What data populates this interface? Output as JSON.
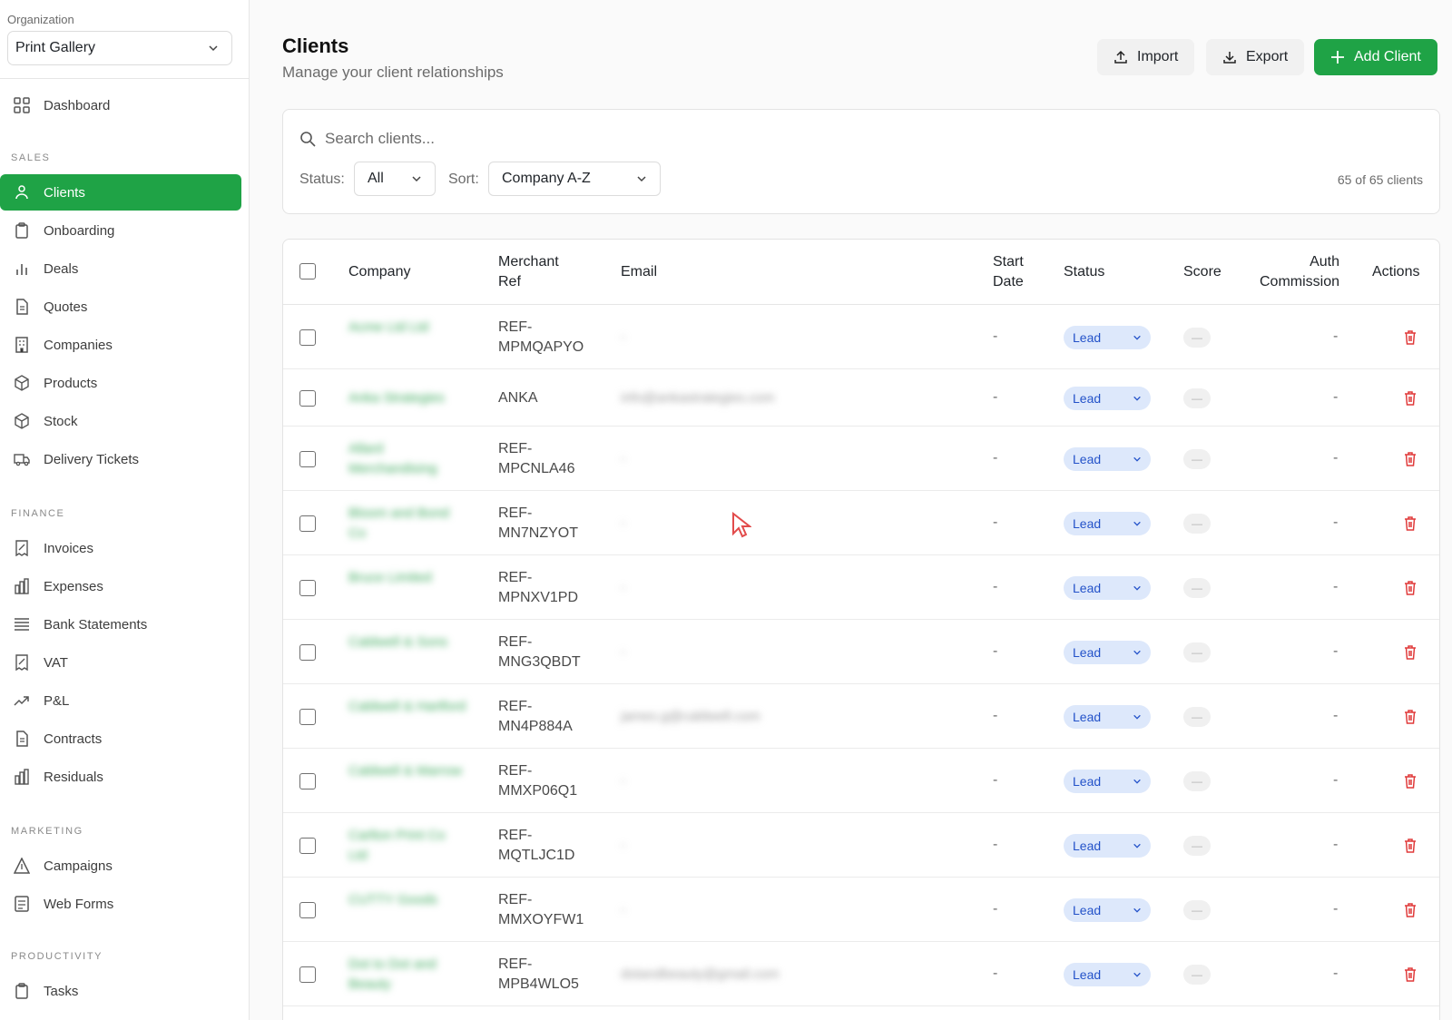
{
  "sidebar": {
    "org_label": "Organization",
    "org_value": "Print Gallery",
    "dashboard": "Dashboard",
    "sections": [
      "Sales",
      "Finance",
      "Marketing",
      "Productivity"
    ],
    "sales": [
      "Clients",
      "Onboarding",
      "Deals",
      "Quotes",
      "Companies",
      "Products",
      "Stock",
      "Delivery Tickets"
    ],
    "finance": [
      "Invoices",
      "Expenses",
      "Bank Statements",
      "VAT",
      "P&L",
      "Contracts",
      "Residuals"
    ],
    "marketing": [
      "Campaigns",
      "Web Forms"
    ],
    "productivity": [
      "Tasks"
    ],
    "active": "Clients"
  },
  "header": {
    "title": "Clients",
    "subtitle": "Manage your client relationships",
    "import": "Import",
    "export": "Export",
    "add": "Add Client"
  },
  "filters": {
    "search_placeholder": "Search clients...",
    "status_label": "Status:",
    "status_value": "All",
    "sort_label": "Sort:",
    "sort_value": "Company A-Z",
    "count": "65 of 65 clients"
  },
  "table": {
    "columns": {
      "company": "Company",
      "merchant_ref_1": "Merchant",
      "merchant_ref_2": "Ref",
      "email": "Email",
      "start_1": "Start",
      "start_2": "Date",
      "status": "Status",
      "score": "Score",
      "auth_1": "Auth",
      "auth_2": "Commission",
      "actions": "Actions"
    },
    "rows": [
      {
        "company": "Acme Ltd Ltd",
        "ref1": "REF-",
        "ref2": "MPMQAPYO",
        "email": "-",
        "start": "-",
        "status": "Lead",
        "score": "—",
        "auth": "-"
      },
      {
        "company": "Anka Strategies",
        "ref1": "ANKA",
        "ref2": "",
        "email": "info@ankastrategies.com",
        "start": "-",
        "status": "Lead",
        "score": "—",
        "auth": "-"
      },
      {
        "company": "Allard Merchandising",
        "ref1": "REF-",
        "ref2": "MPCNLA46",
        "email": "-",
        "start": "-",
        "status": "Lead",
        "score": "—",
        "auth": "-"
      },
      {
        "company": "Bloom and Bond Co",
        "ref1": "REF-",
        "ref2": "MN7NZYOT",
        "email": "-",
        "start": "-",
        "status": "Lead",
        "score": "—",
        "auth": "-"
      },
      {
        "company": "Bruce Limited",
        "ref1": "REF-",
        "ref2": "MPNXV1PD",
        "email": "-",
        "start": "-",
        "status": "Lead",
        "score": "—",
        "auth": "-"
      },
      {
        "company": "Caldwell & Sons",
        "ref1": "REF-",
        "ref2": "MNG3QBDT",
        "email": "-",
        "start": "-",
        "status": "Lead",
        "score": "—",
        "auth": "-"
      },
      {
        "company": "Caldwell & Hartford",
        "ref1": "REF-",
        "ref2": "MN4P884A",
        "email": "james.g@caldwell.com",
        "start": "-",
        "status": "Lead",
        "score": "—",
        "auth": "-"
      },
      {
        "company": "Caldwell & Marrow",
        "ref1": "REF-",
        "ref2": "MMXP06Q1",
        "email": "-",
        "start": "-",
        "status": "Lead",
        "score": "—",
        "auth": "-"
      },
      {
        "company": "Carlton Print Co Ltd",
        "ref1": "REF-",
        "ref2": "MQTLJC1D",
        "email": "-",
        "start": "-",
        "status": "Lead",
        "score": "—",
        "auth": "-"
      },
      {
        "company": "CUTTY Goods",
        "ref1": "REF-",
        "ref2": "MMXOYFW1",
        "email": "-",
        "start": "-",
        "status": "Lead",
        "score": "—",
        "auth": "-"
      },
      {
        "company": "Dot to Dot and Beauty",
        "ref1": "REF-",
        "ref2": "MPB4WLO5",
        "email": "dotandbeauty@gmail.com",
        "start": "-",
        "status": "Lead",
        "score": "—",
        "auth": "-"
      }
    ]
  },
  "colors": {
    "accent": "#1fa346",
    "status_bg": "#dde8fb",
    "status_text": "#2352c9",
    "danger": "#e03a3a"
  }
}
